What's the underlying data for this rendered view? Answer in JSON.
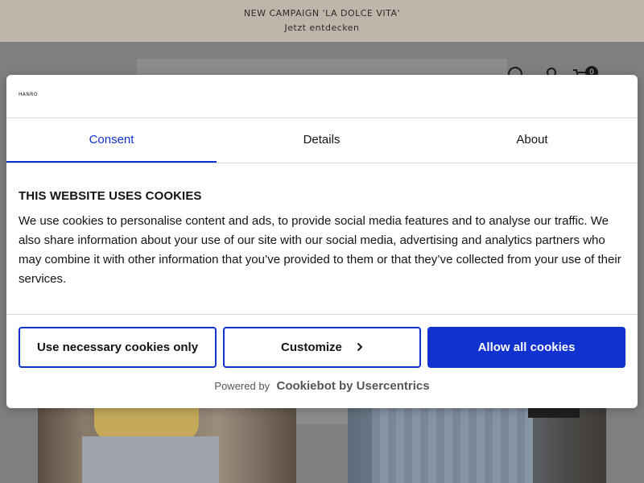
{
  "promo": {
    "line1": "NEW CAMPAIGN 'LA DOLCE VITA'",
    "line2": "Jetzt entdecken"
  },
  "header": {
    "cart_count": "0",
    "icons": [
      "search-icon",
      "user-icon",
      "cart-icon"
    ]
  },
  "dialog": {
    "logo": "HANRO",
    "tabs": [
      {
        "label": "Consent",
        "active": true
      },
      {
        "label": "Details",
        "active": false
      },
      {
        "label": "About",
        "active": false
      }
    ],
    "heading": "THIS WEBSITE USES COOKIES",
    "body": "We use cookies to personalise content and ads, to provide social media features and to analyse our traffic. We also share information about your use of our site with our social media, advertising and analytics partners who may combine it with other information that you’ve provided to them or that they’ve collected from your use of their services.",
    "buttons": {
      "necessary": "Use necessary cookies only",
      "customize": "Customize",
      "allow": "Allow all cookies"
    },
    "powered_prefix": "Powered by",
    "powered_brand": "Cookiebot by Usercentrics"
  },
  "colors": {
    "accent": "#1032cf",
    "promo_bg": "#bfb5ab",
    "overlay": "#7f7f7f"
  }
}
